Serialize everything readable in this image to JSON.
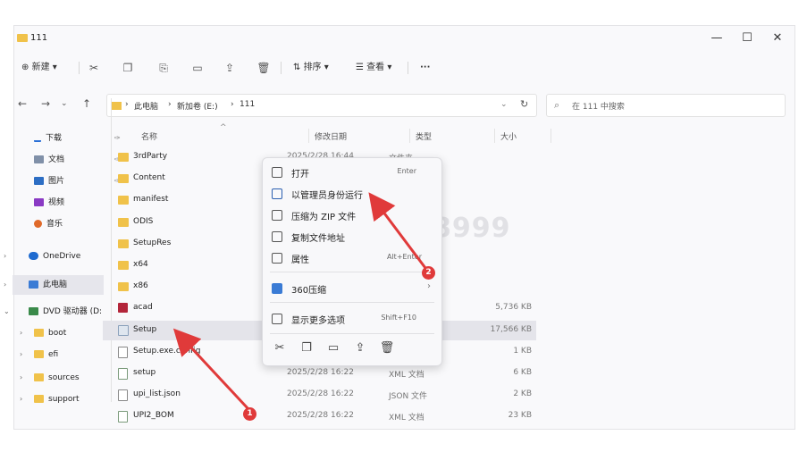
{
  "window": {
    "title": "111",
    "controls": {
      "minimize": "—",
      "maximize": "☐",
      "close": "✕"
    }
  },
  "toolbar": {
    "new_label": "新建",
    "sort_label": "排序",
    "view_label": "查看",
    "more_label": "···"
  },
  "address": {
    "crumbs": [
      "此电脑",
      "新加卷 (E:)",
      "111"
    ],
    "search_placeholder": "在 111 中搜索"
  },
  "sidebar": {
    "items": [
      {
        "label": "下载",
        "icon": "download-icon"
      },
      {
        "label": "文档",
        "icon": "document-icon"
      },
      {
        "label": "图片",
        "icon": "picture-icon"
      },
      {
        "label": "视频",
        "icon": "video-icon"
      },
      {
        "label": "音乐",
        "icon": "music-icon"
      },
      {
        "label": "OneDrive",
        "icon": "cloud-icon"
      },
      {
        "label": "此电脑",
        "icon": "computer-icon"
      },
      {
        "label": "DVD 驱动器 (D:",
        "icon": "dvd-icon"
      },
      {
        "label": "boot",
        "icon": "folder-icon"
      },
      {
        "label": "efi",
        "icon": "folder-icon"
      },
      {
        "label": "sources",
        "icon": "folder-icon"
      },
      {
        "label": "support",
        "icon": "folder-icon"
      }
    ]
  },
  "columns": {
    "name": "名称",
    "date": "修改日期",
    "type": "类型",
    "size": "大小"
  },
  "files": [
    {
      "name": "3rdParty",
      "date": "2025/2/28 16:44",
      "type": "文件夹",
      "size": "",
      "kind": "folder"
    },
    {
      "name": "Content",
      "date": "",
      "type": "",
      "size": "",
      "kind": "folder"
    },
    {
      "name": "manifest",
      "date": "",
      "type": "",
      "size": "",
      "kind": "folder"
    },
    {
      "name": "ODIS",
      "date": "",
      "type": "",
      "size": "",
      "kind": "folder"
    },
    {
      "name": "SetupRes",
      "date": "",
      "type": "",
      "size": "",
      "kind": "folder"
    },
    {
      "name": "x64",
      "date": "",
      "type": "",
      "size": "",
      "kind": "folder"
    },
    {
      "name": "x86",
      "date": "",
      "type": "",
      "size": "",
      "kind": "folder"
    },
    {
      "name": "acad",
      "date": "",
      "type": "序",
      "size": "5,736 KB",
      "kind": "acad"
    },
    {
      "name": "Setup",
      "date": "",
      "type": "序",
      "size": "17,566 KB",
      "kind": "setup"
    },
    {
      "name": "Setup.exe.config",
      "date": "",
      "type": "G 文件",
      "size": "1 KB",
      "kind": "file"
    },
    {
      "name": "setup",
      "date": "2025/2/28 16:22",
      "type": "XML 文档",
      "size": "6 KB",
      "kind": "xml"
    },
    {
      "name": "upi_list.json",
      "date": "2025/2/28 16:22",
      "type": "JSON 文件",
      "size": "2 KB",
      "kind": "file"
    },
    {
      "name": "UPI2_BOM",
      "date": "2025/2/28 16:22",
      "type": "XML 文档",
      "size": "23 KB",
      "kind": "xml"
    }
  ],
  "context_menu": {
    "items": [
      {
        "label": "打开",
        "shortcut": "Enter",
        "icon": "open-icon"
      },
      {
        "label": "以管理员身份运行",
        "shortcut": "",
        "icon": "shield-icon"
      },
      {
        "label": "压缩为 ZIP 文件",
        "shortcut": "",
        "icon": "zip-icon"
      },
      {
        "label": "复制文件地址",
        "shortcut": "",
        "icon": "copy-path-icon"
      },
      {
        "label": "属性",
        "shortcut": "Alt+Enter",
        "icon": "properties-icon"
      },
      {
        "label": "360压缩",
        "shortcut": "",
        "icon": "compress-360-icon"
      },
      {
        "label": "显示更多选项",
        "shortcut": "Shift+F10",
        "icon": "more-options-icon"
      }
    ]
  },
  "watermark": "tian888999",
  "annotations": {
    "badge1": "1",
    "badge2": "2"
  },
  "colors": {
    "accent_arrow": "#e03a3a",
    "folder": "#f0c24a",
    "selection": "#e4e4ea"
  }
}
